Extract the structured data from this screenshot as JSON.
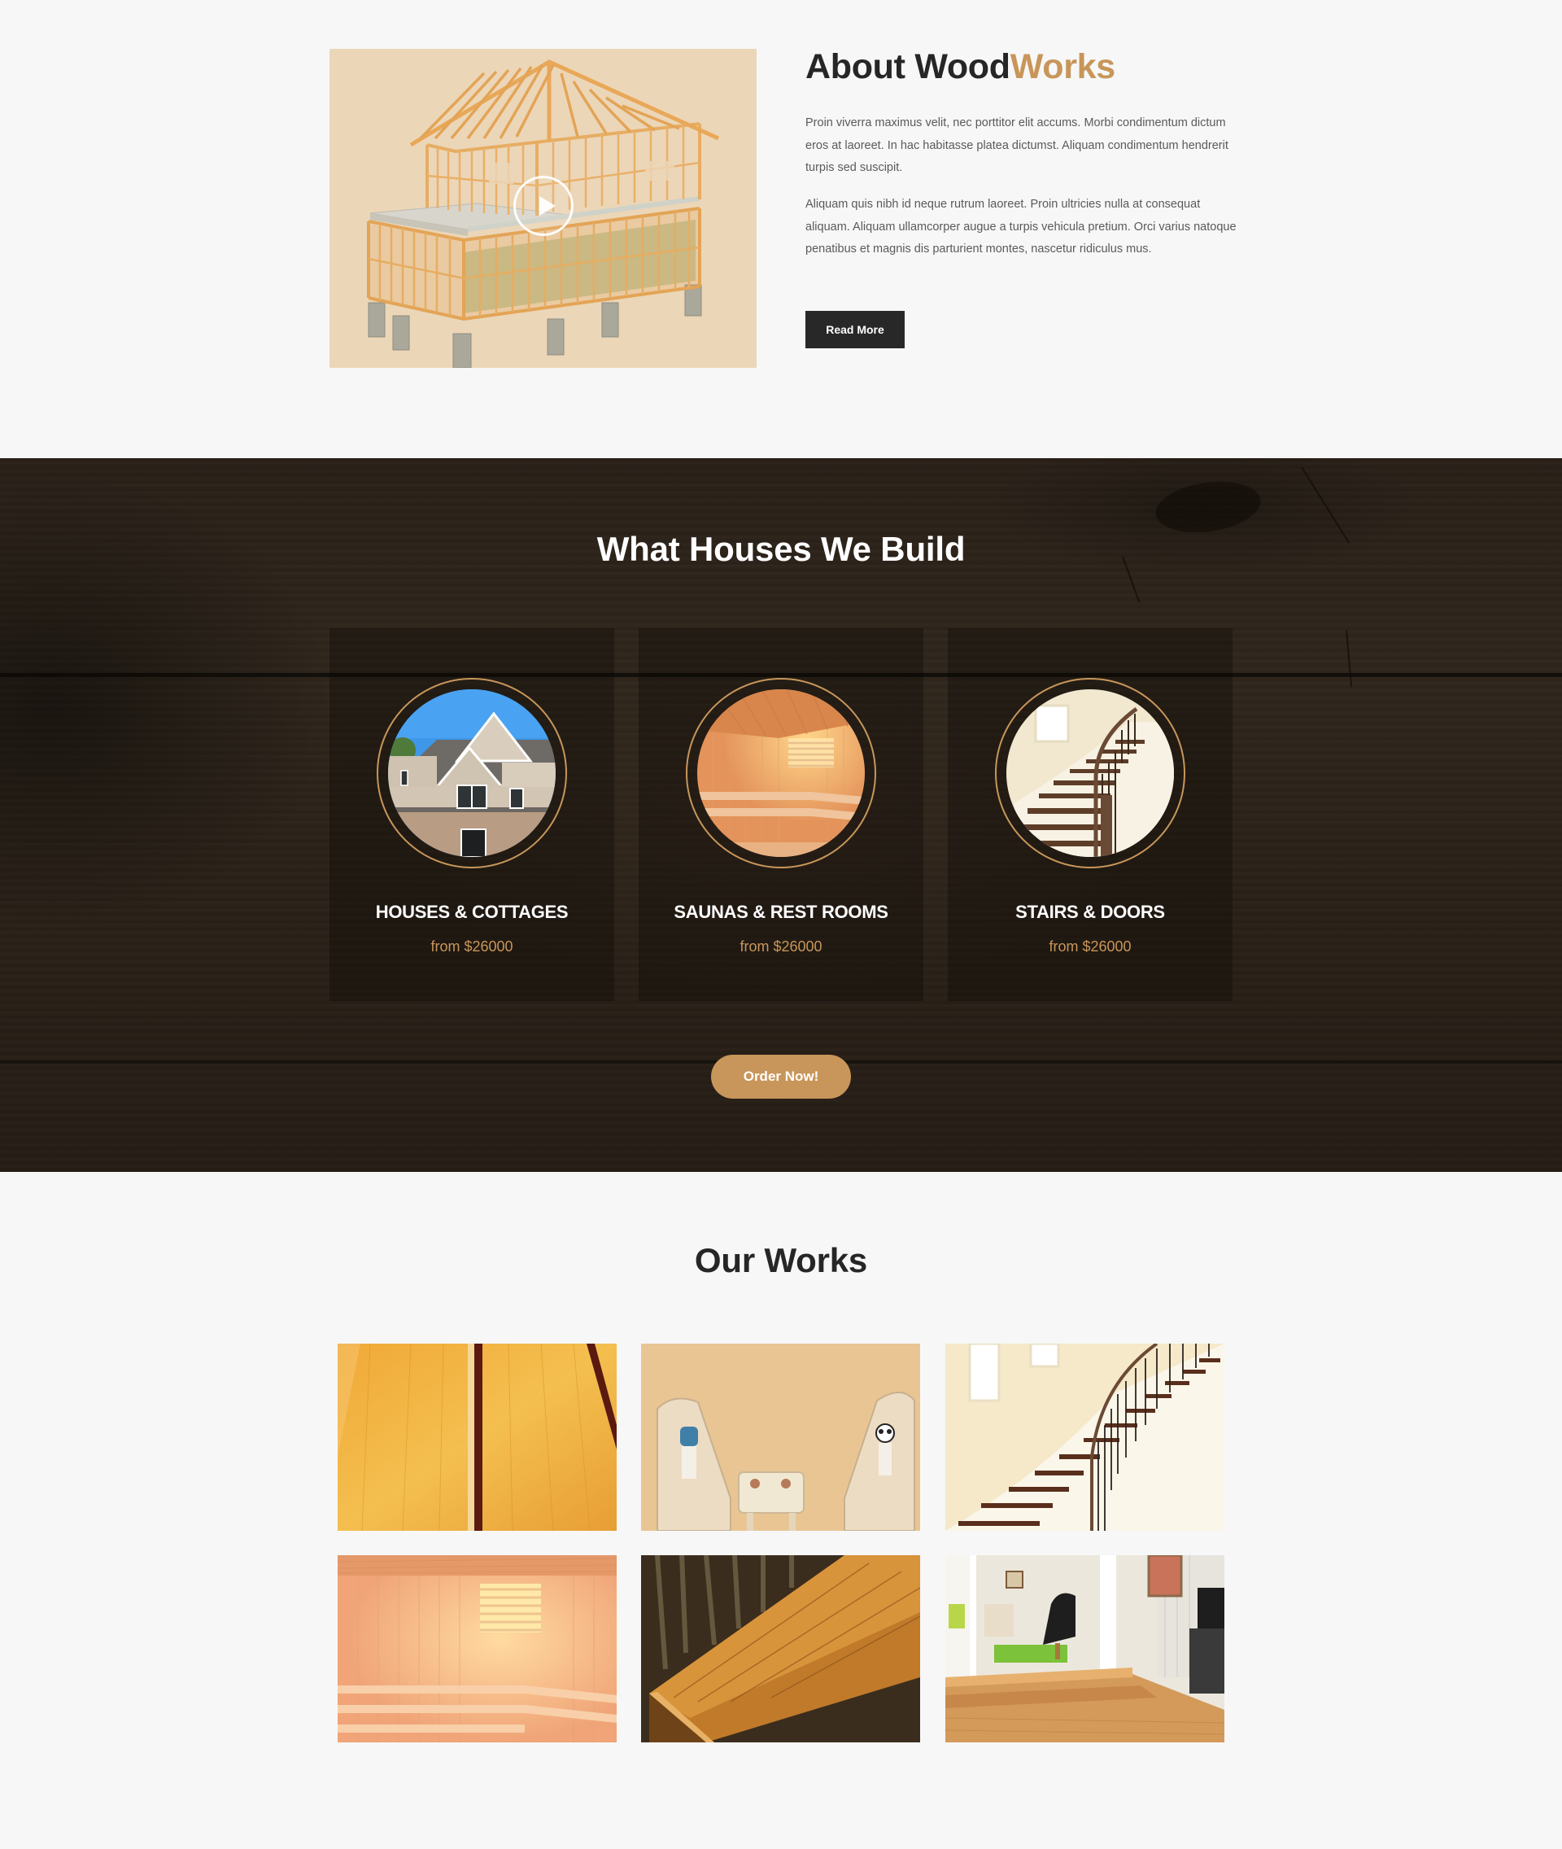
{
  "about": {
    "title_main": "About Wood",
    "title_accent": "Works",
    "paragraphs": [
      "Proin viverra maximus velit, nec porttitor elit accums. Morbi condimentum dictum eros at laoreet. In hac habitasse platea dictumst. Aliquam condimentum hendrerit turpis sed suscipit.",
      "Aliquam quis nibh id neque rutrum laoreet. Proin ultricies nulla at consequat aliquam. Aliquam ullamcorper augue a turpis vehicula pretium. Orci varius natoque penatibus et magnis dis parturient montes, nascetur ridiculus mus."
    ],
    "read_more_label": "Read More",
    "video": {
      "icon": "play-icon",
      "image": "timber-frame-house"
    }
  },
  "build": {
    "title": "What Houses We Build",
    "cards": [
      {
        "title": "HOUSES & COTTAGES",
        "price": "from $26000",
        "image": "suburban-house"
      },
      {
        "title": "SAUNAS & REST ROOMS",
        "price": "from $26000",
        "image": "wooden-sauna"
      },
      {
        "title": "STAIRS & DOORS",
        "price": "from $26000",
        "image": "spiral-staircase"
      }
    ],
    "order_label": "Order Now!"
  },
  "works": {
    "title": "Our Works",
    "items": [
      {
        "image": "wood-planks"
      },
      {
        "image": "kids-furniture"
      },
      {
        "image": "curved-staircase"
      },
      {
        "image": "sauna-interior"
      },
      {
        "image": "wooden-tabletop"
      },
      {
        "image": "living-room-steps"
      }
    ]
  },
  "colors": {
    "accent": "#c8965a",
    "dark_button": "#282828",
    "page_bg": "#f7f7f7",
    "section_dark": "#2e251b"
  }
}
